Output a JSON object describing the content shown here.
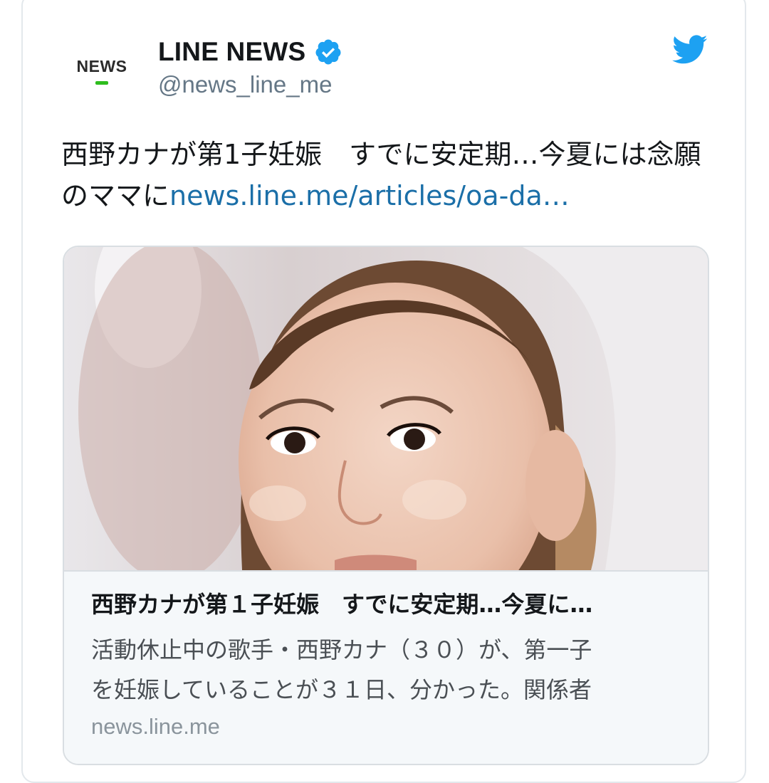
{
  "account": {
    "avatar_text": "NEWS",
    "display_name": "LINE NEWS",
    "handle": "@news_line_me",
    "verified": true,
    "verified_icon": "verified-badge-icon",
    "platform_icon": "twitter-bird-icon",
    "avatar_accent_color": "#2ebd1e"
  },
  "tweet": {
    "text": "西野カナが第1子妊娠　すでに安定期…今夏には念願のママに",
    "link_text": "news.line.me/articles/oa-da…",
    "link_color": "#1b6fa8"
  },
  "card": {
    "image_description_icon": "photo-icon",
    "title": "西野カナが第１子妊娠　すでに安定期…今夏に…",
    "description_line1": "活動休止中の歌手・西野カナ（３０）が、第一子",
    "description_line2": "を妊娠していることが３１日、分かった。関係者",
    "domain": "news.line.me"
  },
  "colors": {
    "brand_blue": "#1da1f2",
    "text_primary": "#14171a",
    "text_secondary": "#657786"
  }
}
